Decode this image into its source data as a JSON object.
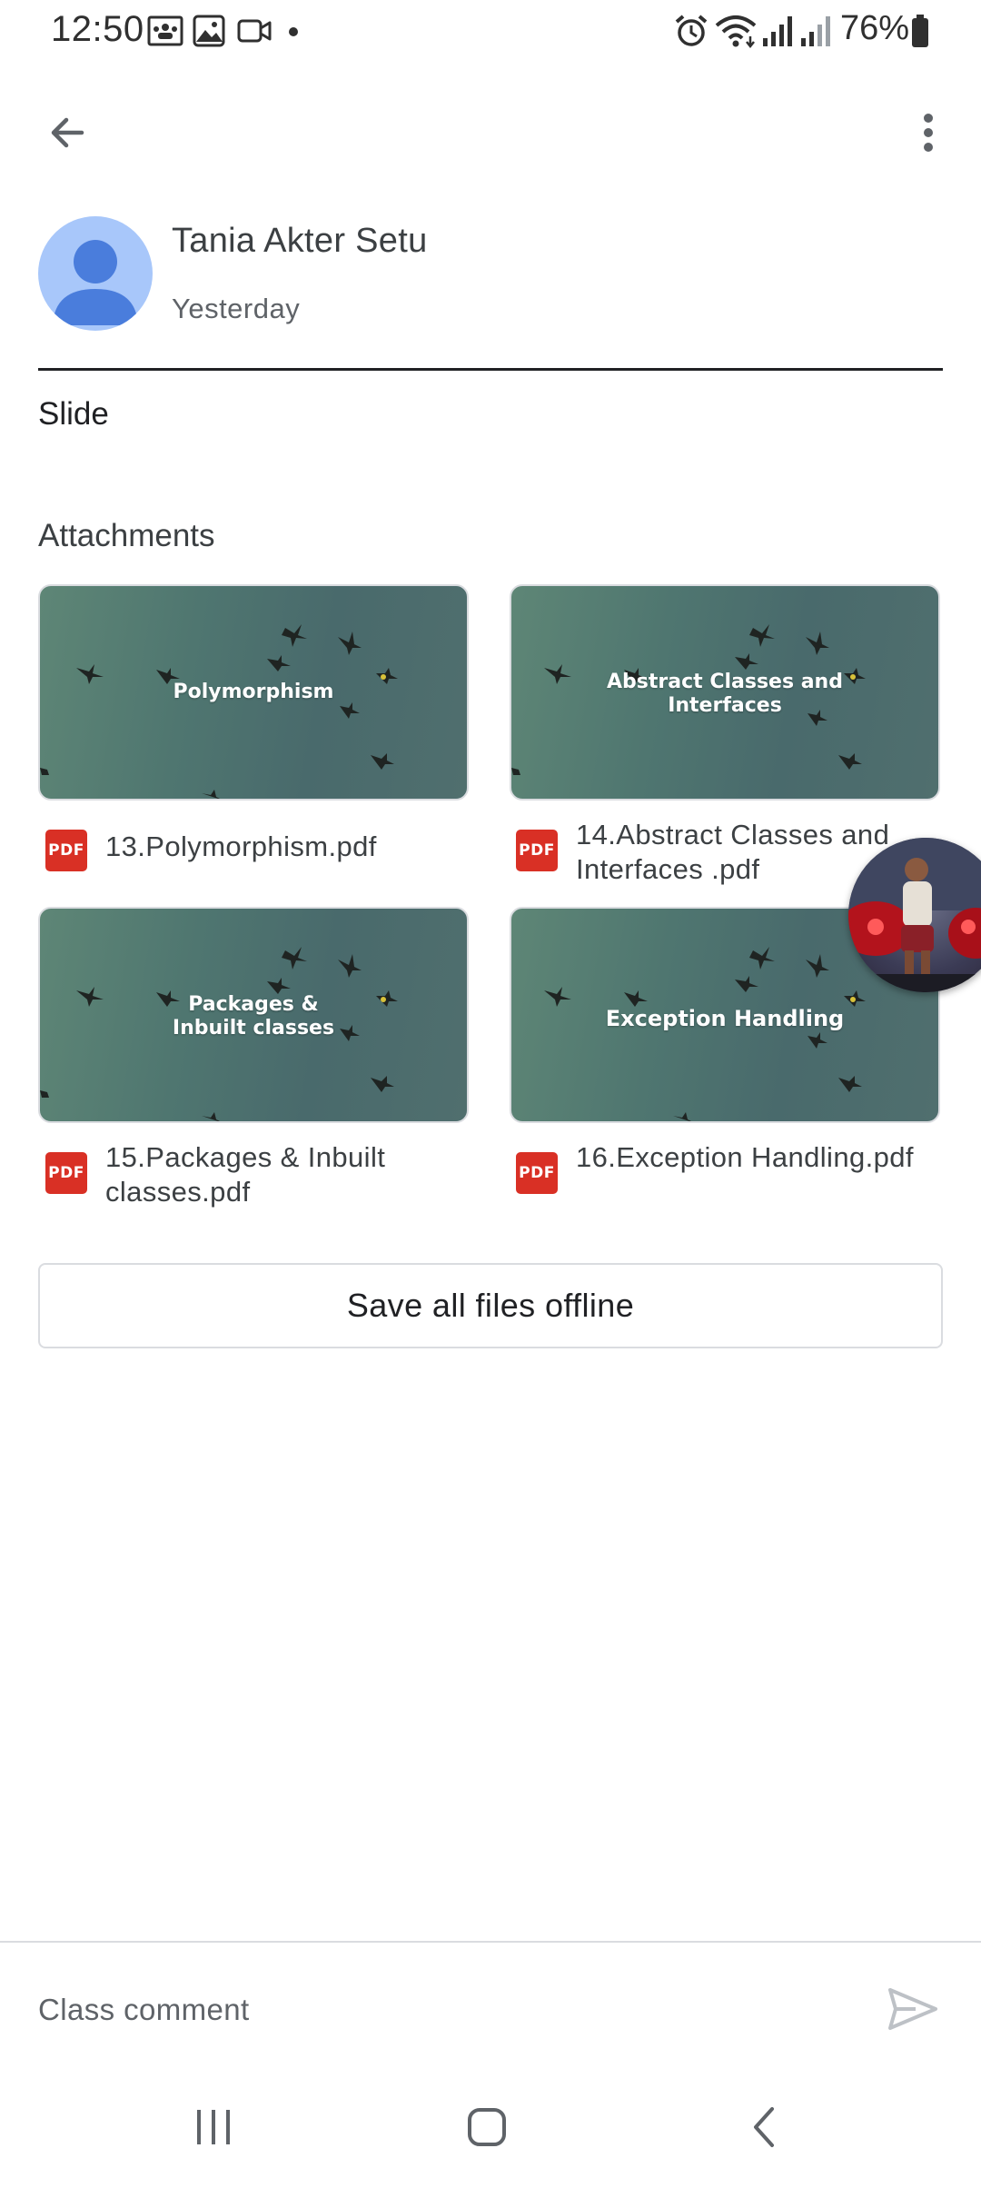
{
  "status_bar": {
    "time": "12:50",
    "battery": "76%"
  },
  "app_bar": {
    "back_icon": "arrow-left-icon",
    "more_icon": "more-vert-icon"
  },
  "post": {
    "author": "Tania Akter Setu",
    "date": "Yesterday",
    "body": "Slide",
    "attachments_heading": "Attachments"
  },
  "attachments": [
    {
      "thumb_title": "Polymorphism",
      "file_name": "13.Polymorphism.pdf",
      "badge": "PDF"
    },
    {
      "thumb_title": "Abstract Classes and Interfaces",
      "file_name": "14.Abstract Classes and Interfaces .pdf",
      "badge": "PDF"
    },
    {
      "thumb_title": "Packages & Inbuilt classes",
      "file_name": "15.Packages & Inbuilt classes.pdf",
      "badge": "PDF"
    },
    {
      "thumb_title": "Exception Handling",
      "file_name": "16.Exception Handling.pdf",
      "badge": "PDF"
    }
  ],
  "actions": {
    "save_offline": "Save all files offline"
  },
  "comment": {
    "placeholder": "Class comment",
    "send_icon": "send-icon"
  },
  "colors": {
    "avatar_bg": "#a8c7fa",
    "avatar_fg": "#4a7ddc",
    "pdf_red": "#d93025",
    "divider": "#dadce0"
  }
}
